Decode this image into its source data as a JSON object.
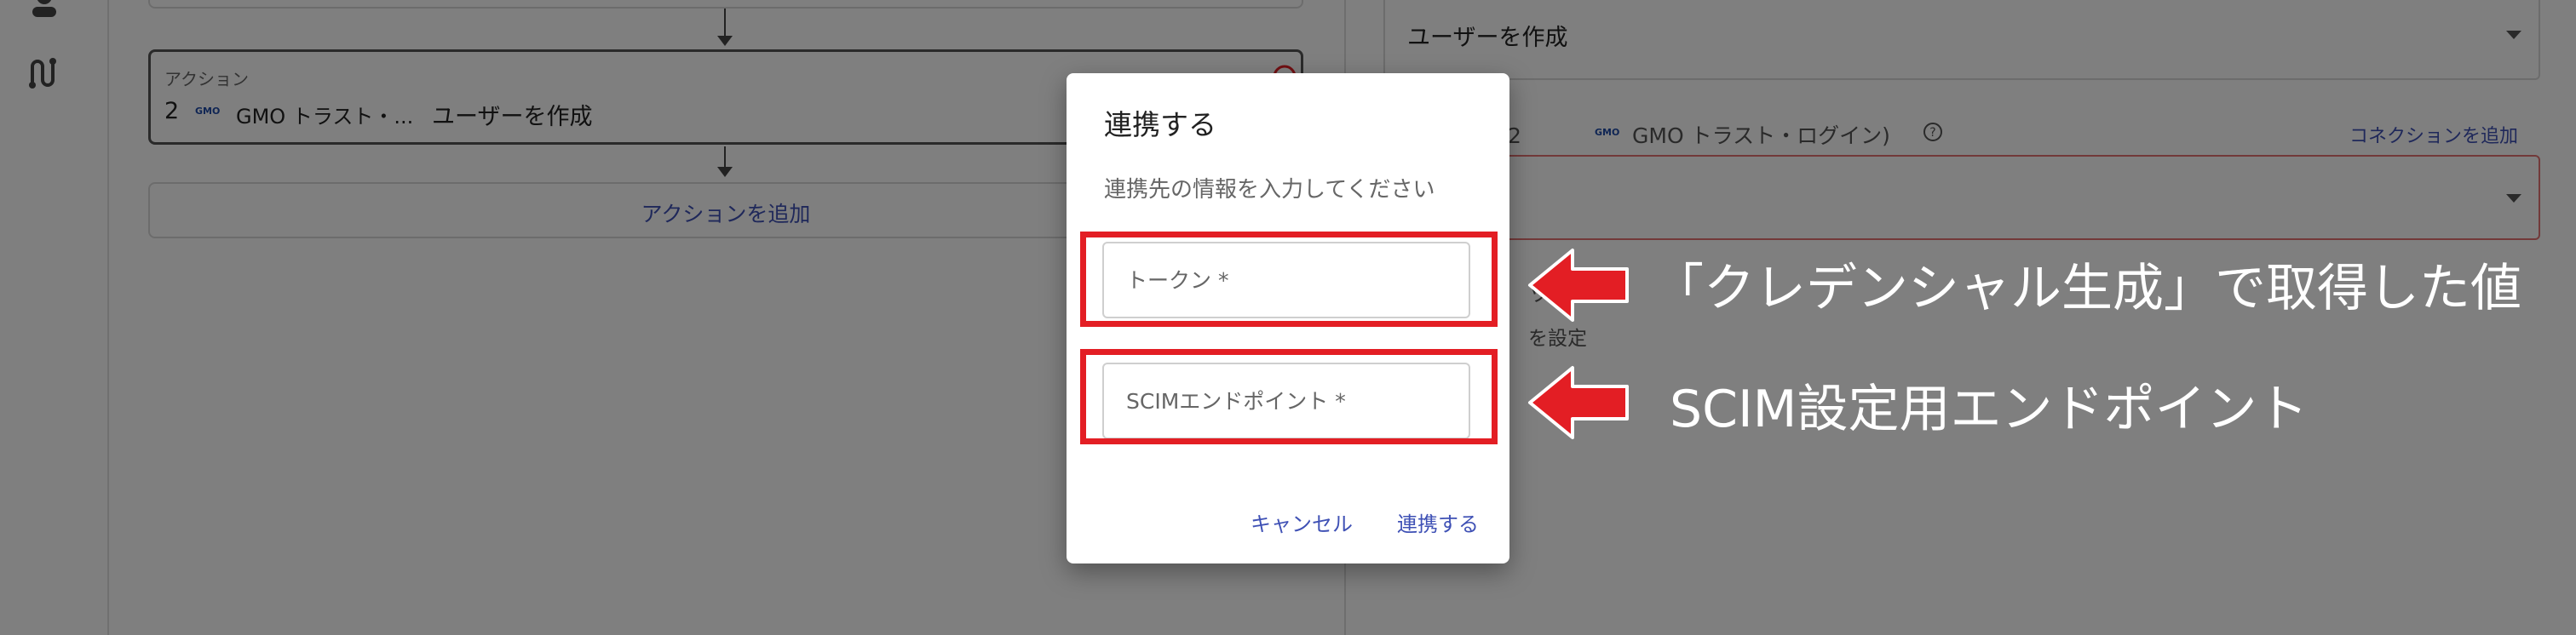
{
  "flow": {
    "action_card": {
      "header": "アクション",
      "step_number": "2",
      "app_logo_text": "GMO",
      "app_name": "GMO トラスト・...",
      "action_name": "ユーザーを作成"
    },
    "add_action_label": "アクションを追加"
  },
  "right_panel": {
    "action_select_value": "ユーザーを作成",
    "connection_label": "ン（2",
    "connection_logo_text": "GMO",
    "connection_app": "GMO トラスト・ログイン)",
    "add_connection_link": "コネクションを追加",
    "partial_text_1": "ップ",
    "partial_text_2": "を設定"
  },
  "dialog": {
    "title": "連携する",
    "description": "連携先の情報を入力してください",
    "token_field": {
      "placeholder": "トークン *",
      "value": ""
    },
    "endpoint_field": {
      "placeholder": "SCIMエンドポイント *",
      "value": ""
    },
    "cancel_label": "キャンセル",
    "confirm_label": "連携する"
  },
  "annotations": {
    "token_callout": "「クレデンシャル生成」で取得した値",
    "endpoint_callout": "SCIM設定用エンドポイント",
    "highlight_color": "#e31e24"
  }
}
